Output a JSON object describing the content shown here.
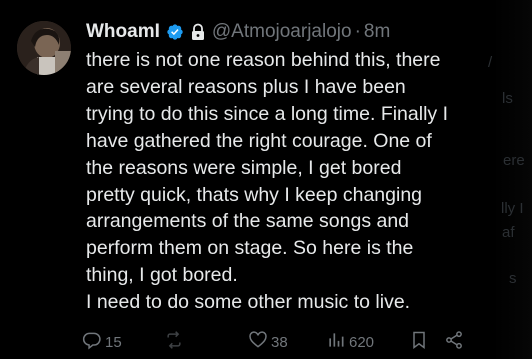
{
  "tweet": {
    "author": {
      "display_name": "WhoamI",
      "handle": "@Atmojoarjalojo",
      "verified": true,
      "protected": true,
      "avatar_icon": "profile-avatar"
    },
    "separator": "·",
    "time": "8m",
    "text_lines": [
      "there is not one reason behind this, there",
      "are several reasons plus I have been",
      "trying to do this since a long time. Finally I",
      "have gathered the right courage. One of",
      "the reasons were simple, I get bored",
      "pretty quick, thats why I keep changing",
      "arrangements of the same songs and",
      "perform them on stage. So here is the",
      "thing, I got bored.",
      "I need to do some other music to live."
    ],
    "actions": {
      "replies": "15",
      "retweets": "",
      "likes": "38",
      "views": "620"
    }
  },
  "background_bleed": [
    "/",
    "ls",
    "ere",
    "lly I",
    "af",
    "s"
  ],
  "colors": {
    "background": "#000000",
    "text": "#e7e9ea",
    "muted": "#71767b",
    "verified": "#1d9bf0"
  }
}
